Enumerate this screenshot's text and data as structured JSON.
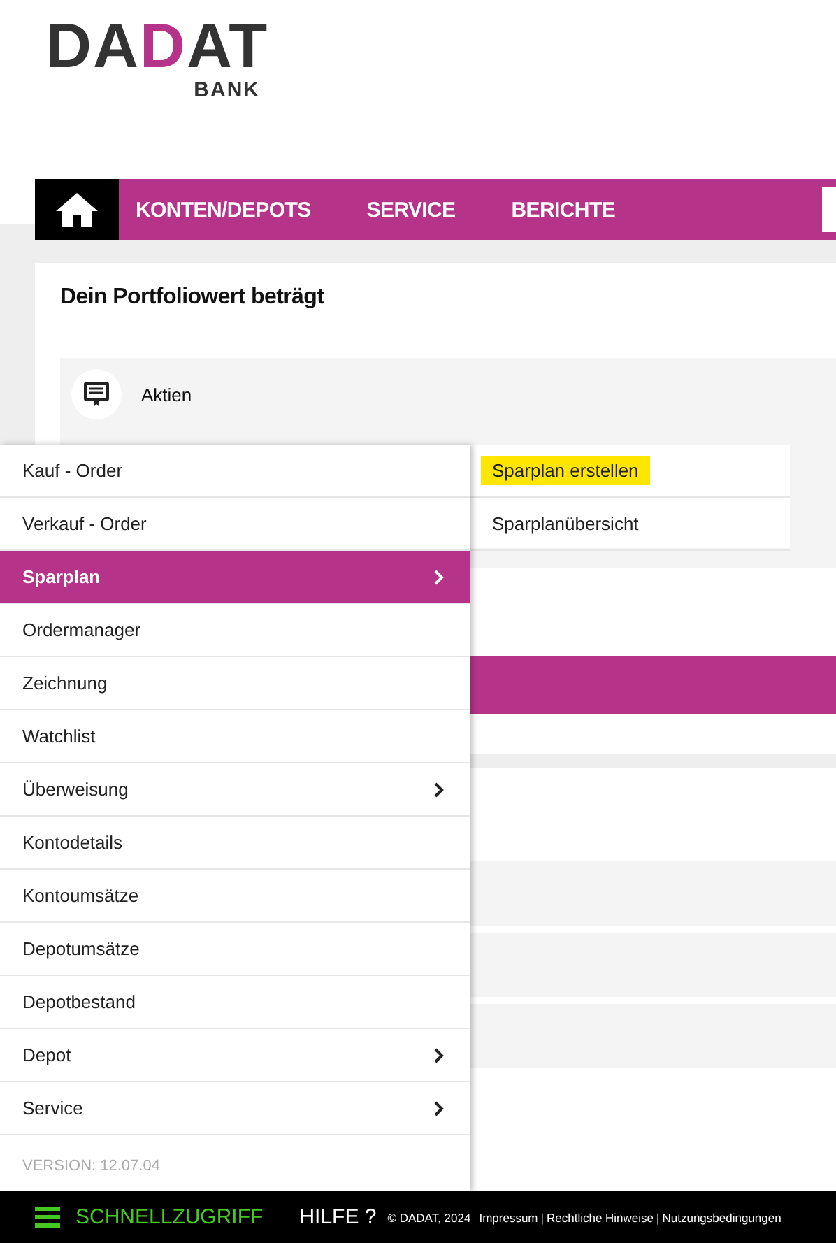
{
  "logo": {
    "text": "DADAT",
    "subtext": "BANK"
  },
  "nav": {
    "items": [
      {
        "label": "KONTEN/DEPOTS"
      },
      {
        "label": "SERVICE"
      },
      {
        "label": "BERICHTE"
      }
    ]
  },
  "portfolio": {
    "title": "Dein Portfoliowert beträgt",
    "category": "Aktien"
  },
  "quick_menu": {
    "items": [
      {
        "label": "Kauf - Order",
        "selected": false,
        "has_submenu": false
      },
      {
        "label": "Verkauf - Order",
        "selected": false,
        "has_submenu": false
      },
      {
        "label": "Sparplan",
        "selected": true,
        "has_submenu": true
      },
      {
        "label": "Ordermanager",
        "selected": false,
        "has_submenu": false
      },
      {
        "label": "Zeichnung",
        "selected": false,
        "has_submenu": false
      },
      {
        "label": "Watchlist",
        "selected": false,
        "has_submenu": false
      },
      {
        "label": "Überweisung",
        "selected": false,
        "has_submenu": true
      },
      {
        "label": "Kontodetails",
        "selected": false,
        "has_submenu": false
      },
      {
        "label": "Kontoumsätze",
        "selected": false,
        "has_submenu": false
      },
      {
        "label": "Depotumsätze",
        "selected": false,
        "has_submenu": false
      },
      {
        "label": "Depotbestand",
        "selected": false,
        "has_submenu": false
      },
      {
        "label": "Depot",
        "selected": false,
        "has_submenu": true
      },
      {
        "label": "Service",
        "selected": false,
        "has_submenu": true
      }
    ],
    "version": "VERSION: 12.07.04",
    "submenu": [
      {
        "label": "Sparplan erstellen",
        "highlighted": true
      },
      {
        "label": "Sparplanübersicht",
        "highlighted": false
      }
    ]
  },
  "footer": {
    "quick_access": "SCHNELLZUGRIFF",
    "help": "HILFE ?",
    "copyright": "© DADAT, 2024",
    "separator": "|",
    "links": [
      "Impressum",
      "Rechtliche Hinweise",
      "Nutzungsbedingungen"
    ]
  }
}
